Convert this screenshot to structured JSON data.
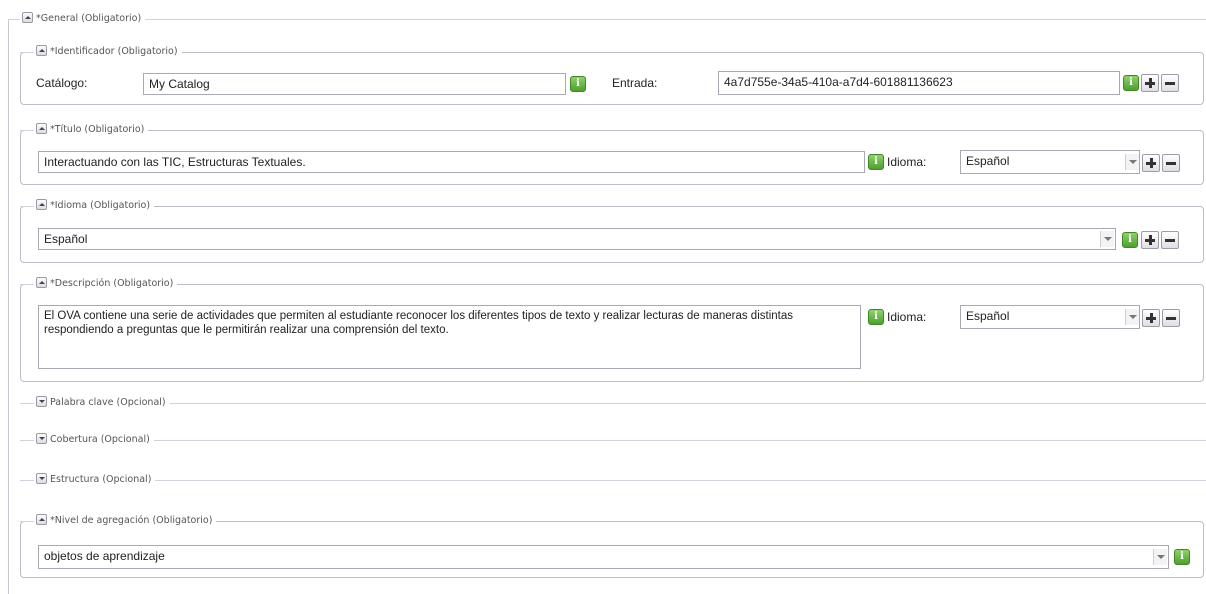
{
  "general": {
    "legend": "*General (Obligatorio)"
  },
  "identificador": {
    "legend": "*Identificador (Obligatorio)",
    "catalogo_label": "Catálogo:",
    "catalogo_value": "My Catalog",
    "entrada_label": "Entrada:",
    "entrada_value": "4a7d755e-34a5-410a-a7d4-601881136623"
  },
  "titulo": {
    "legend": "*Título (Obligatorio)",
    "value": "Interactuando con las TIC, Estructuras Textuales.",
    "idioma_label": "Idioma:",
    "idioma_value": "Español"
  },
  "idioma": {
    "legend": "*Idioma (Obligatorio)",
    "value": "Español"
  },
  "descripcion": {
    "legend": "*Descripción (Obligatorio)",
    "value": "El OVA contiene una serie de actividades que permiten al estudiante reconocer los diferentes tipos de texto y realizar lecturas de maneras distintas respondiendo a preguntas que le permitirán realizar una comprensión del texto.",
    "idioma_label": "Idioma:",
    "idioma_value": "Español"
  },
  "palabra_clave": {
    "legend": "Palabra clave (Opcional)"
  },
  "cobertura": {
    "legend": "Cobertura (Opcional)"
  },
  "estructura": {
    "legend": "Estructura (Opcional)"
  },
  "nivel_agregacion": {
    "legend": "*Nivel de agregación (Obligatorio)",
    "value": "objetos de aprendizaje"
  },
  "icons": {
    "info": "info-icon",
    "add": "plus-icon",
    "remove": "minus-icon",
    "collapse": "chevron-up-icon",
    "expand": "chevron-down-icon",
    "dropdown": "chevron-down-icon"
  },
  "colors": {
    "info_green": "#5aa838",
    "border": "#bcbcc8"
  }
}
